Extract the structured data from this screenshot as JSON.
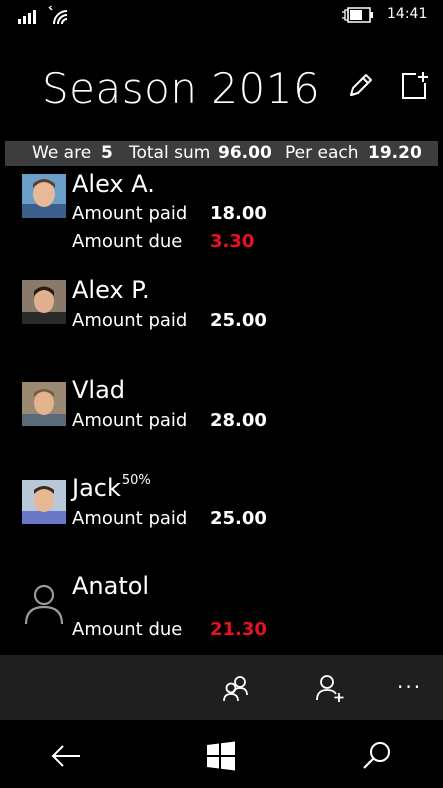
{
  "status": {
    "time": "14:41"
  },
  "header": {
    "title": "Season 2016"
  },
  "summary": {
    "we_are_label": "We are",
    "we_are_value": "5",
    "total_label": "Total sum",
    "total_value": "96.00",
    "each_label": "Per each",
    "each_value": "19.20"
  },
  "people": [
    {
      "name": "Alex A.",
      "badge": "",
      "paid_label": "Amount paid",
      "paid": "18.00",
      "due_label": "Amount due",
      "due": "3.30"
    },
    {
      "name": "Alex P.",
      "badge": "",
      "paid_label": "Amount paid",
      "paid": "25.00"
    },
    {
      "name": "Vlad",
      "badge": "",
      "paid_label": "Amount paid",
      "paid": "28.00"
    },
    {
      "name": "Jack",
      "badge": "50%",
      "paid_label": "Amount paid",
      "paid": "25.00"
    },
    {
      "name": "Anatol",
      "badge": "",
      "due_label": "Amount due",
      "due": "21.30"
    }
  ],
  "appbar": {
    "more": "..."
  },
  "colors": {
    "due": "#e81123",
    "summary_bg": "#3d3d3d",
    "appbar_bg": "#1f1f1f"
  }
}
